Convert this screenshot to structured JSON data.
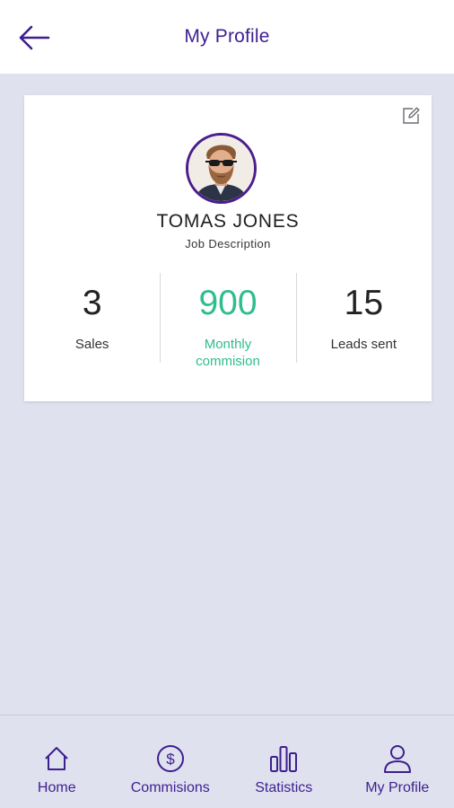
{
  "header": {
    "title": "My Profile",
    "back_icon": "arrow-left-icon"
  },
  "profile": {
    "name": "TOMAS JONES",
    "job": "Job Description",
    "edit_icon": "edit-icon"
  },
  "stats": [
    {
      "value": "3",
      "label": "Sales",
      "accent": false
    },
    {
      "value": "900",
      "label": "Monthly commision",
      "accent": true
    },
    {
      "value": "15",
      "label": "Leads sent",
      "accent": false
    }
  ],
  "nav": [
    {
      "label": "Home",
      "icon": "home-icon"
    },
    {
      "label": "Commisions",
      "icon": "dollar-circle-icon"
    },
    {
      "label": "Statistics",
      "icon": "bar-chart-icon"
    },
    {
      "label": "My Profile",
      "icon": "user-icon"
    }
  ],
  "colors": {
    "primary": "#3d1f8f",
    "accent": "#2ebd8d",
    "background": "#e0e1ef"
  }
}
